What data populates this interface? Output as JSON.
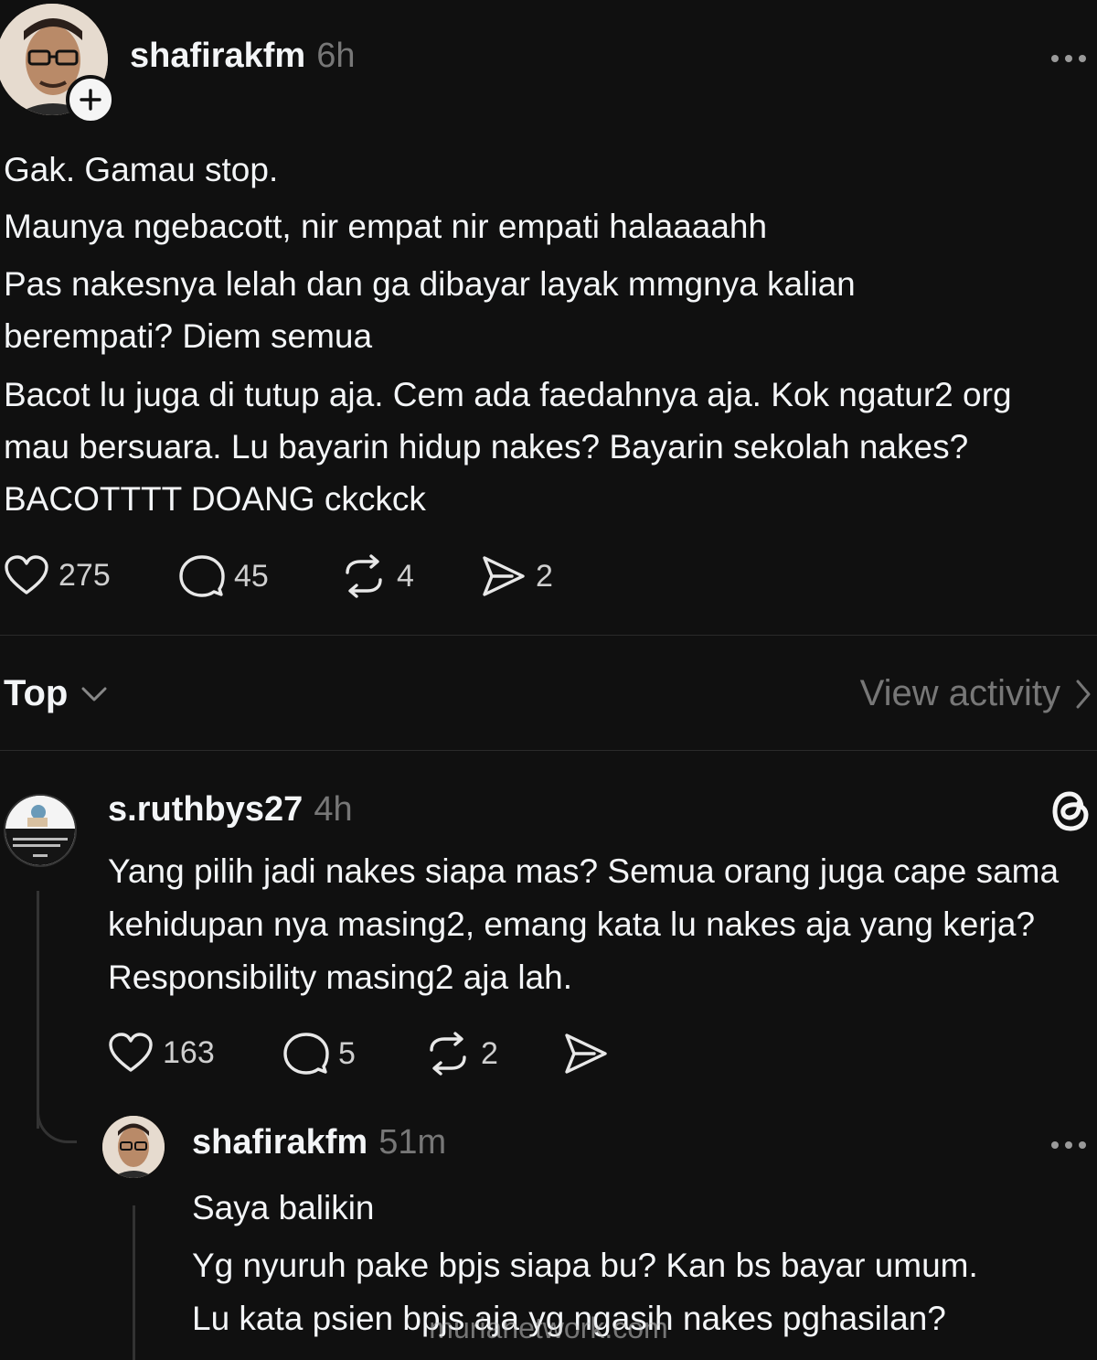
{
  "post": {
    "username": "shafirakfm",
    "time": "6h",
    "follow_icon": "plus-icon",
    "lines": [
      "Gak. Gamau stop.",
      "Maunya ngebacott, nir empat nir empati halaaaahh",
      "Pas nakesnya lelah dan ga dibayar layak mmgnya kalian berempati? Diem semua",
      "Bacot lu juga di tutup aja. Cem ada faedahnya aja. Kok ngatur2 org mau bersuara. Lu bayarin hidup nakes? Bayarin sekolah nakes? BACOTTTT DOANG ckckck"
    ],
    "likes": "275",
    "replies": "45",
    "reposts": "4",
    "shares": "2"
  },
  "sort": {
    "label": "Top",
    "view_activity": "View activity"
  },
  "reply1": {
    "username": "s.ruthbys27",
    "time": "4h",
    "text": "Yang pilih jadi nakes siapa mas? Semua orang juga cape sama kehidupan nya masing2, emang kata lu nakes aja yang kerja? Responsibility masing2 aja lah.",
    "likes": "163",
    "replies": "5",
    "reposts": "2"
  },
  "reply2": {
    "username": "shafirakfm",
    "time": "51m",
    "line1": "Saya balikin",
    "line2": "Yg nyuruh pake bpjs siapa bu? Kan bs bayar umum.",
    "line3": "Lu kata psien bpjs aja yg ngasih nakes pghasilan?"
  },
  "watermark": "murianetwork.com"
}
